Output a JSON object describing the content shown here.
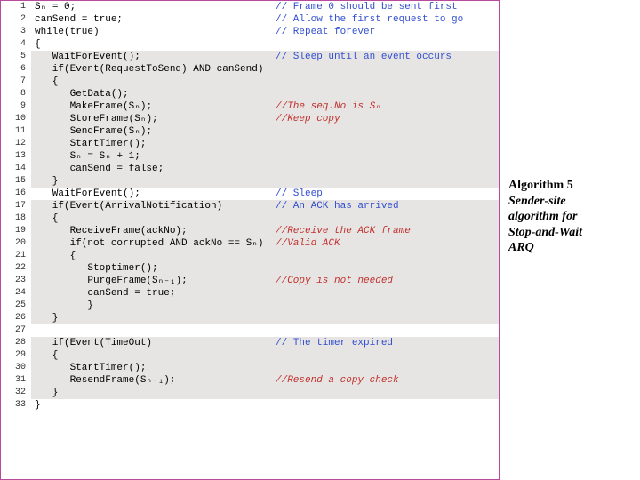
{
  "side": {
    "title_word": "Algorithm",
    "title_num": "5",
    "desc_l1": "Sender-site",
    "desc_l2": "algorithm for",
    "desc_l3": "Stop-and-Wait",
    "desc_l4": "ARQ"
  },
  "lines": [
    {
      "n": 1,
      "shade": false,
      "code": "Sₙ = 0;",
      "cmt": "// Frame 0 should be sent first",
      "ctype": "blue"
    },
    {
      "n": 2,
      "shade": false,
      "code": "canSend = true;",
      "cmt": "// Allow the first request to go",
      "ctype": "blue"
    },
    {
      "n": 3,
      "shade": false,
      "code": "while(true)",
      "cmt": "// Repeat forever",
      "ctype": "blue"
    },
    {
      "n": 4,
      "shade": false,
      "code": "{",
      "cmt": "",
      "ctype": ""
    },
    {
      "n": 5,
      "shade": true,
      "code": "   WaitForEvent();",
      "cmt": "// Sleep until an event occurs",
      "ctype": "blue"
    },
    {
      "n": 6,
      "shade": true,
      "code": "   if(Event(RequestToSend) AND canSend)",
      "cmt": "",
      "ctype": ""
    },
    {
      "n": 7,
      "shade": true,
      "code": "   {",
      "cmt": "",
      "ctype": ""
    },
    {
      "n": 8,
      "shade": true,
      "code": "      GetData();",
      "cmt": "",
      "ctype": ""
    },
    {
      "n": 9,
      "shade": true,
      "code": "      MakeFrame(Sₙ);",
      "cmt": "//The seq.No is Sₙ",
      "ctype": "red"
    },
    {
      "n": 10,
      "shade": true,
      "code": "      StoreFrame(Sₙ);",
      "cmt": "//Keep copy",
      "ctype": "red"
    },
    {
      "n": 11,
      "shade": true,
      "code": "      SendFrame(Sₙ);",
      "cmt": "",
      "ctype": ""
    },
    {
      "n": 12,
      "shade": true,
      "code": "      StartTimer();",
      "cmt": "",
      "ctype": ""
    },
    {
      "n": 13,
      "shade": true,
      "code": "      Sₙ = Sₙ + 1;",
      "cmt": "",
      "ctype": ""
    },
    {
      "n": 14,
      "shade": true,
      "code": "      canSend = false;",
      "cmt": "",
      "ctype": ""
    },
    {
      "n": 15,
      "shade": true,
      "code": "   }",
      "cmt": "",
      "ctype": ""
    },
    {
      "n": 16,
      "shade": false,
      "code": "   WaitForEvent();",
      "cmt": "// Sleep",
      "ctype": "blue"
    },
    {
      "n": 17,
      "shade": true,
      "code": "   if(Event(ArrivalNotification)",
      "cmt": "// An ACK has arrived",
      "ctype": "blue"
    },
    {
      "n": 18,
      "shade": true,
      "code": "   {",
      "cmt": "",
      "ctype": ""
    },
    {
      "n": 19,
      "shade": true,
      "code": "      ReceiveFrame(ackNo);",
      "cmt": "//Receive the ACK frame",
      "ctype": "red"
    },
    {
      "n": 20,
      "shade": true,
      "code": "      if(not corrupted AND ackNo == Sₙ)",
      "cmt": "//Valid ACK",
      "ctype": "red"
    },
    {
      "n": 21,
      "shade": true,
      "code": "      {",
      "cmt": "",
      "ctype": ""
    },
    {
      "n": 22,
      "shade": true,
      "code": "         Stoptimer();",
      "cmt": "",
      "ctype": ""
    },
    {
      "n": 23,
      "shade": true,
      "code": "         PurgeFrame(Sₙ₋₁);",
      "cmt": "//Copy is not needed",
      "ctype": "red"
    },
    {
      "n": 24,
      "shade": true,
      "code": "         canSend = true;",
      "cmt": "",
      "ctype": ""
    },
    {
      "n": 25,
      "shade": true,
      "code": "         }",
      "cmt": "",
      "ctype": ""
    },
    {
      "n": 26,
      "shade": true,
      "code": "   }",
      "cmt": "",
      "ctype": ""
    },
    {
      "n": 27,
      "shade": false,
      "code": "",
      "cmt": "",
      "ctype": ""
    },
    {
      "n": 28,
      "shade": true,
      "code": "   if(Event(TimeOut)",
      "cmt": "// The timer expired",
      "ctype": "blue"
    },
    {
      "n": 29,
      "shade": true,
      "code": "   {",
      "cmt": "",
      "ctype": ""
    },
    {
      "n": 30,
      "shade": true,
      "code": "      StartTimer();",
      "cmt": "",
      "ctype": ""
    },
    {
      "n": 31,
      "shade": true,
      "code": "      ResendFrame(Sₙ₋₁);",
      "cmt": "//Resend a copy check",
      "ctype": "red"
    },
    {
      "n": 32,
      "shade": true,
      "code": "   }",
      "cmt": "",
      "ctype": ""
    },
    {
      "n": 33,
      "shade": false,
      "code": "}",
      "cmt": "",
      "ctype": ""
    }
  ]
}
